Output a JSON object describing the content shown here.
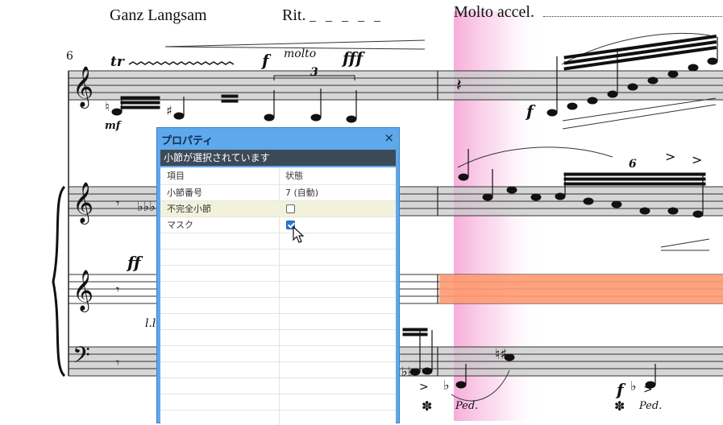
{
  "score": {
    "tempo_marks": [
      "Ganz Langsam",
      "Rit.",
      "_ _ _ _ _",
      "Molto accel."
    ],
    "measure_number": "6",
    "dynamics": {
      "tr": "tr",
      "mf": "mf",
      "f": "f",
      "molto": "molto",
      "fff": "fff",
      "triplet": "3",
      "f2": "f",
      "ff": "ff",
      "sextuplet": "6",
      "ll": "l.l",
      "f3": "f"
    },
    "pedal": [
      "Ped.",
      "Ped."
    ],
    "colors": {
      "staff_fill": "#c8c8c8",
      "pink_highlight": "#f6a9d8",
      "orange_bar": "#ff9970"
    }
  },
  "panel": {
    "title": "プロパティ",
    "close_glyph": "×",
    "status": "小節が選択されています",
    "columns": [
      "項目",
      "状態"
    ],
    "rows": [
      {
        "label": "小節番号",
        "value": "7 (自動)",
        "type": "text"
      },
      {
        "label": "不完全小節",
        "value": "unchecked",
        "type": "checkbox"
      },
      {
        "label": "マスク",
        "value": "checked",
        "type": "checkbox"
      }
    ],
    "colors": {
      "frame": "#5ea8ec",
      "status_bg": "#3c4a57"
    }
  }
}
